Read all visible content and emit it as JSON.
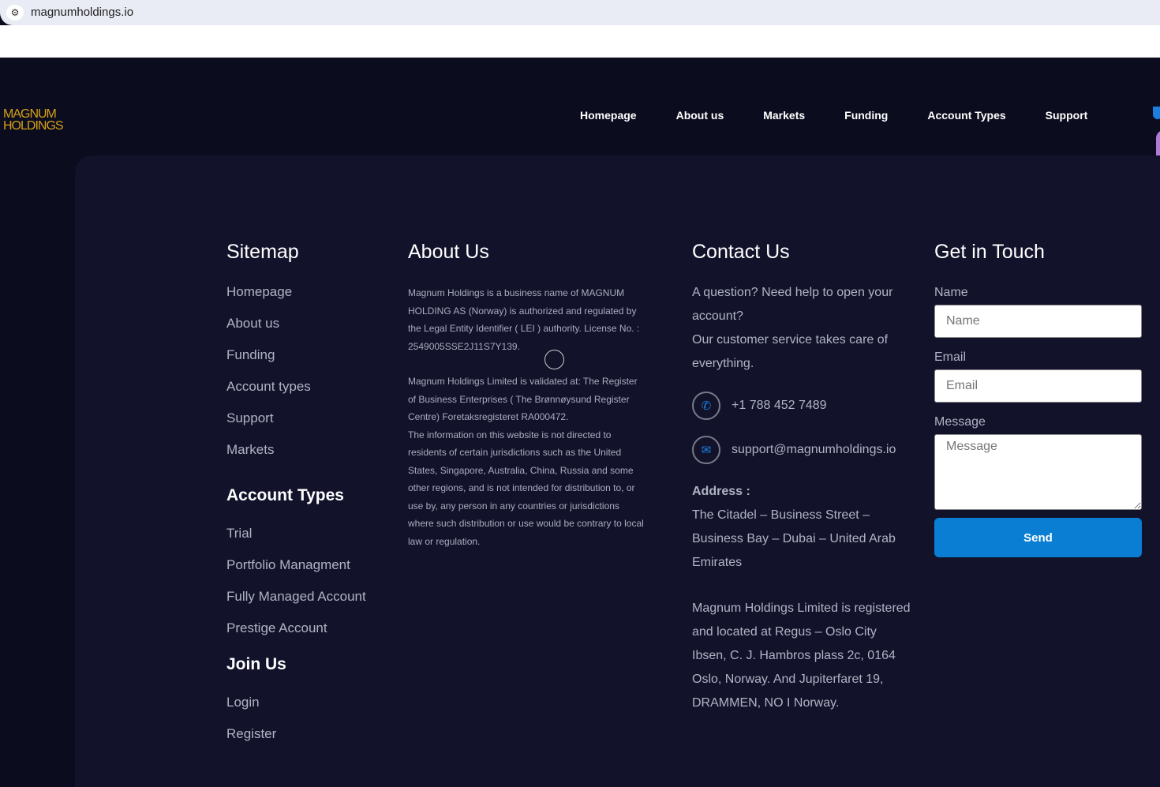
{
  "browser": {
    "url": "magnumholdings.io"
  },
  "logo": {
    "line1": "MAGNUM",
    "line2": "HOLDINGS"
  },
  "nav": [
    "Homepage",
    "About us",
    "Markets",
    "Funding",
    "Account Types",
    "Support"
  ],
  "sitemap": {
    "title": "Sitemap",
    "items": [
      "Homepage",
      "About us",
      "Funding",
      "Account types",
      "Support",
      "Markets"
    ]
  },
  "account_types": {
    "title": "Account Types",
    "items": [
      "Trial",
      "Portfolio Managment",
      "Fully Managed Account",
      "Prestige Account"
    ]
  },
  "join": {
    "title": "Join Us",
    "items": [
      "Login",
      "Register"
    ]
  },
  "about": {
    "title": "About Us",
    "p1": "Magnum Holdings is a business name of MAGNUM HOLDING AS (Norway) is authorized and regulated by the Legal Entity Identifier ( LEI ) authority. License No. : 2549005SSE2J11S7Y139.",
    "p2": "Magnum Holdings Limited is validated at: The Register of Business Enterprises ( The Brønnøysund Register Centre) Foretaksregisteret RA000472.",
    "p3": "The information on this website is not directed to residents of certain jurisdictions such as the United States, Singapore, Australia, China, Russia and some other regions, and is not intended for distribution to, or use by, any person in any countries or jurisdictions where such distribution or use would be contrary to local law or regulation."
  },
  "contact": {
    "title": "Contact Us",
    "intro1": "A question? Need help to open your account?",
    "intro2": "Our customer service takes care of everything.",
    "phone": "+1 788 452 7489",
    "email": "support@magnumholdings.io",
    "address_label": "Address :",
    "address": "The Citadel – Business Street – Business Bay – Dubai – United Arab Emirates",
    "registered": "Magnum Holdings Limited is registered and located at Regus – Oslo City Ibsen, C. J. Hambros plass 2c, 0164 Oslo, Norway. And Jupiterfaret 19, DRAMMEN, NO I Norway."
  },
  "form": {
    "title": "Get in Touch",
    "name_label": "Name",
    "name_placeholder": "Name",
    "email_label": "Email",
    "email_placeholder": "Email",
    "message_label": "Message",
    "message_placeholder": "Message",
    "send": "Send"
  },
  "colors": {
    "accent": "#0a7ed3",
    "logo": "#d4a017",
    "bg": "#0b0c1e",
    "panel": "#12132b"
  }
}
